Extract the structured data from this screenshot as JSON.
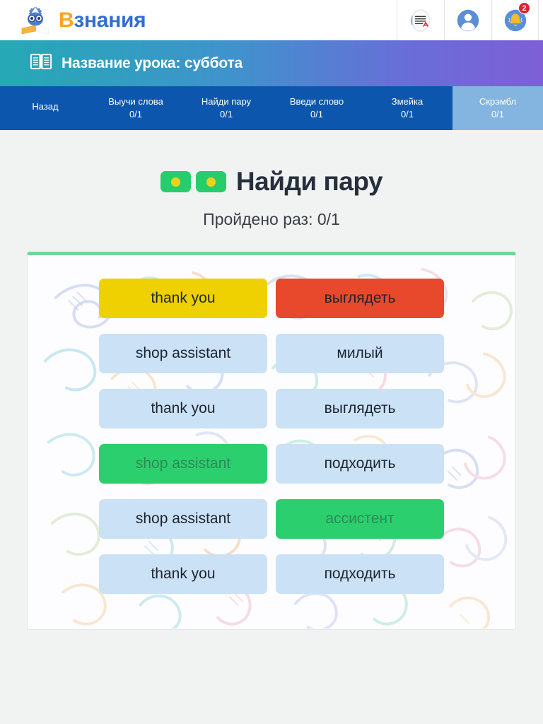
{
  "topbar": {
    "logo": {
      "icon": "owl-book-logo-icon",
      "first_letter": "В",
      "rest": "знания"
    },
    "icons": [
      {
        "name": "translate-document-icon",
        "label": "Переводчик"
      },
      {
        "name": "user-profile-icon",
        "label": "Профиль"
      },
      {
        "name": "notification-bell-icon",
        "label": "Уведомления",
        "badge": "2"
      }
    ]
  },
  "lesson": {
    "icon": "open-book-icon",
    "title": "Название урока: суббота"
  },
  "tabs": [
    {
      "label": "Назад",
      "count": "",
      "active": false
    },
    {
      "label": "Выучи слова",
      "count": "0/1",
      "active": false
    },
    {
      "label": "Найди пару",
      "count": "0/1",
      "active": false
    },
    {
      "label": "Введи слово",
      "count": "0/1",
      "active": false
    },
    {
      "label": "Змейка",
      "count": "0/1",
      "active": false
    },
    {
      "label": "Скрэмбл",
      "count": "0/1",
      "active": true
    }
  ],
  "game": {
    "icon": "pair-chips-icon",
    "title": "Найди пару",
    "subtitle": "Пройдено раз: 0/1"
  },
  "board": {
    "rows": [
      {
        "left": {
          "text": "thank you",
          "state": "yellow"
        },
        "right": {
          "text": "выглядеть",
          "state": "red"
        }
      },
      {
        "left": {
          "text": "shop assistant",
          "state": "default"
        },
        "right": {
          "text": "милый",
          "state": "default"
        }
      },
      {
        "left": {
          "text": "thank you",
          "state": "default"
        },
        "right": {
          "text": "выглядеть",
          "state": "default"
        }
      },
      {
        "left": {
          "text": "shop assistant",
          "state": "green"
        },
        "right": {
          "text": "подходить",
          "state": "default"
        }
      },
      {
        "left": {
          "text": "shop assistant",
          "state": "default"
        },
        "right": {
          "text": "ассистент",
          "state": "green"
        }
      },
      {
        "left": {
          "text": "thank you",
          "state": "default"
        },
        "right": {
          "text": "подходить",
          "state": "default"
        }
      }
    ]
  },
  "colors": {
    "tile_default": "#cbe2f6",
    "tile_selected_yellow": "#efd000",
    "tile_wrong_red": "#e8492c",
    "tile_matched_green": "#2ccf6e",
    "tabbar": "#0d56ad",
    "tab_active": "#84b4e0",
    "page_bg": "#f1f2f2",
    "brand_orange": "#f5a623",
    "brand_blue": "#2f6fd0",
    "badge_red": "#e0202e"
  }
}
